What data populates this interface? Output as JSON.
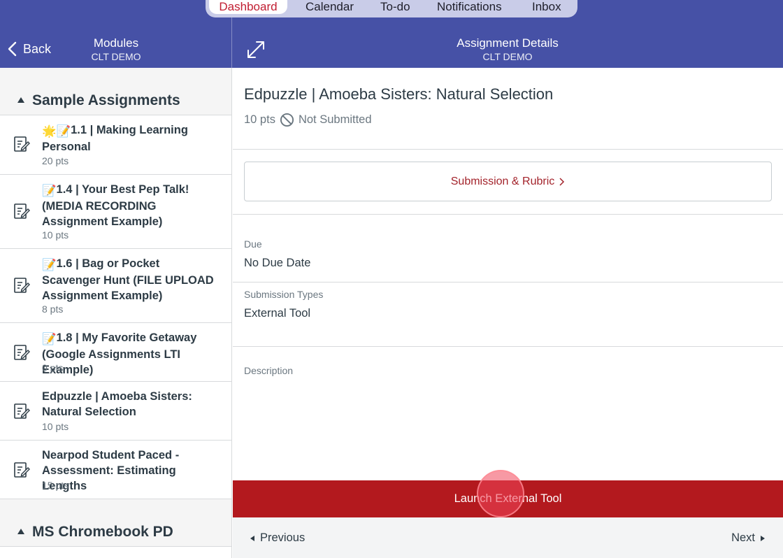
{
  "top_tabs": [
    "Dashboard",
    "Calendar",
    "To-do",
    "Notifications",
    "Inbox"
  ],
  "header": {
    "back_label": "Back",
    "left_title": "Modules",
    "left_subtitle": "CLT DEMO",
    "right_title": "Assignment Details",
    "right_subtitle": "CLT DEMO"
  },
  "modules": {
    "section1": "Sample Assignments",
    "section2": "MS Chromebook PD",
    "items": [
      {
        "title": "1.1 | Making Learning Personal",
        "emoji": "🌟📝",
        "points": "20 pts"
      },
      {
        "title": "1.4 | Your Best Pep Talk! (MEDIA RECORDING Assignment Example)",
        "emoji": "📝",
        "points": "10 pts"
      },
      {
        "title": "1.6 | Bag or Pocket Scavenger Hunt (FILE UPLOAD Assignment Example)",
        "emoji": "📝",
        "points": "8 pts"
      },
      {
        "title": "1.8 | My Favorite Getaway (Google Assignments LTI Example)",
        "emoji": "📝",
        "points": "0 pts"
      },
      {
        "title": "Edpuzzle | Amoeba Sisters: Natural Selection",
        "emoji": "",
        "points": "10 pts"
      },
      {
        "title": "Nearpod Student Paced - Assessment: Estimating Lengths",
        "emoji": "",
        "points": "15 pts"
      }
    ]
  },
  "assignment": {
    "title": "Edpuzzle | Amoeba Sisters: Natural Selection",
    "points": "10 pts",
    "status": "Not Submitted",
    "submission_button": "Submission & Rubric",
    "due_label": "Due",
    "due_value": "No Due Date",
    "types_label": "Submission Types",
    "types_value": "External Tool",
    "description_label": "Description"
  },
  "actions": {
    "launch": "Launch External Tool",
    "previous": "Previous",
    "next": "Next"
  },
  "colors": {
    "header": "#4651a6",
    "accent_red": "#b3191e",
    "link_red": "#a3232b"
  }
}
